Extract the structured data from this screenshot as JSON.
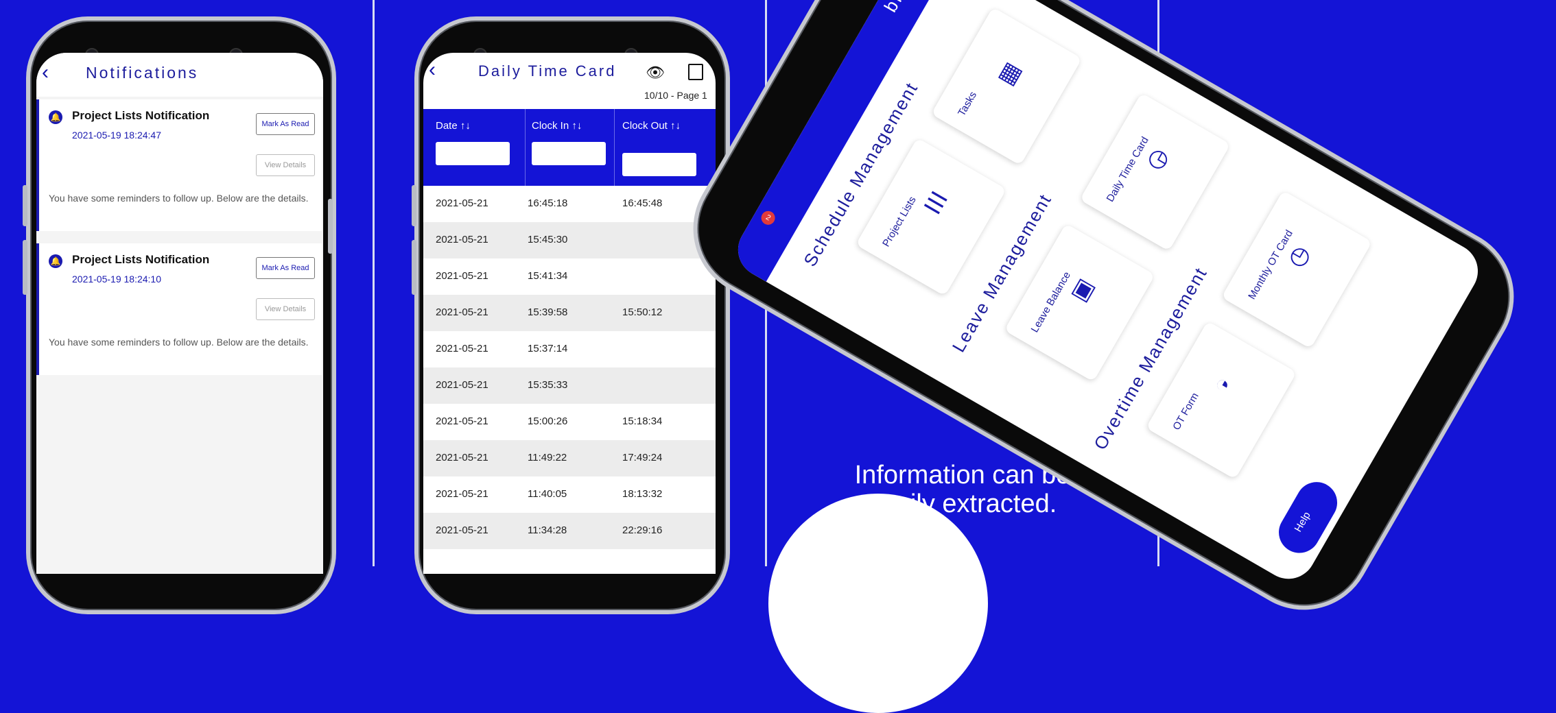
{
  "panel1": {
    "title": "Notifications",
    "notifications": [
      {
        "title": "Project Lists Notification",
        "time": "2021-05-19 18:24:47",
        "mark_read": "Mark As Read",
        "view": "View Details",
        "text": "You have some reminders to follow up. Below are the details."
      },
      {
        "title": "Project Lists Notification",
        "time": "2021-05-19 18:24:10",
        "mark_read": "Mark As Read",
        "view": "View Details",
        "text": "You have some reminders to follow up. Below are the details."
      }
    ]
  },
  "panel2": {
    "title": "Daily Time Card",
    "pager": "10/10 - Page 1",
    "columns": [
      "Date",
      "Clock In",
      "Clock Out"
    ],
    "rows": [
      [
        "2021-05-21",
        "16:45:18",
        "16:45:48"
      ],
      [
        "2021-05-21",
        "15:45:30",
        ""
      ],
      [
        "2021-05-21",
        "15:41:34",
        ""
      ],
      [
        "2021-05-21",
        "15:39:58",
        "15:50:12"
      ],
      [
        "2021-05-21",
        "15:37:14",
        ""
      ],
      [
        "2021-05-21",
        "15:35:33",
        ""
      ],
      [
        "2021-05-21",
        "15:00:26",
        "15:18:34"
      ],
      [
        "2021-05-21",
        "11:49:22",
        "17:49:24"
      ],
      [
        "2021-05-21",
        "11:40:05",
        "18:13:32"
      ],
      [
        "2021-05-21",
        "11:34:28",
        "22:29:16"
      ]
    ]
  },
  "panel3": {
    "caption_line1": "Information can be",
    "caption_line2": "easily extracted."
  },
  "panel4": {
    "brand": "bizzsync",
    "notif_count": "2",
    "sections": [
      "Schedule Management",
      "Leave Management",
      "Overtime Management"
    ],
    "tiles": [
      "Tasks",
      "Project Lists",
      "Daily Time Card",
      "Leave Balance",
      "Monthly OT Card",
      "OT Form"
    ],
    "help": "Help"
  },
  "colors": {
    "brand_blue": "#1414d6",
    "accent_navy": "#1c1c9c"
  }
}
